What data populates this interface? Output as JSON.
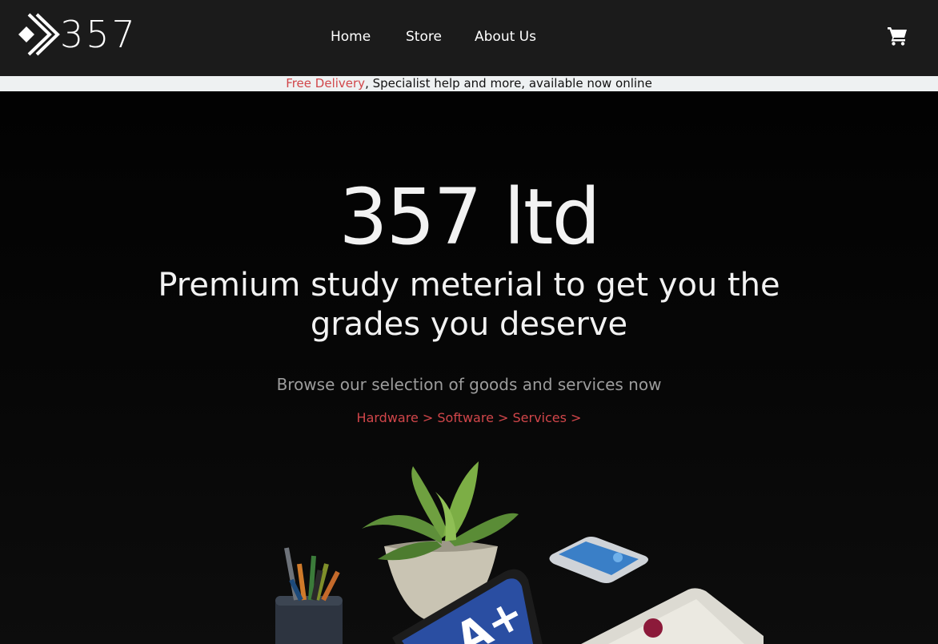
{
  "header": {
    "logo_text": "357",
    "nav": [
      {
        "label": "Home"
      },
      {
        "label": "Store"
      },
      {
        "label": "About Us"
      }
    ],
    "cart_icon": "shopping-cart-icon"
  },
  "banner": {
    "accent_text": "Free Delivery",
    "rest_text": ", Specialist help and more, available now online"
  },
  "hero": {
    "title": "357 ltd",
    "subtitle": "Premium study meterial to get you the grades you deserve",
    "browse_text": "Browse our selection of goods and services now",
    "links": [
      {
        "label": "Hardware >"
      },
      {
        "label": "Software >"
      },
      {
        "label": "Services >"
      }
    ],
    "tablet_text": "A+"
  },
  "colors": {
    "header_bg": "#1b1b1b",
    "banner_bg": "#eef1f2",
    "accent": "#d1464a",
    "hero_bg": "#050505",
    "text_light": "#f2f2f2",
    "text_muted": "#9c9c9c"
  }
}
